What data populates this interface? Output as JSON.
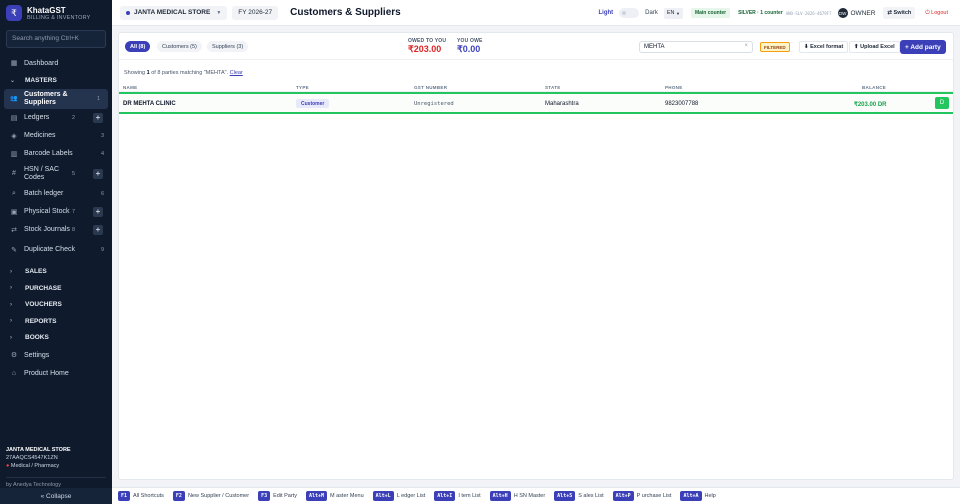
{
  "sidebar": {
    "brand_name": "KhataGST",
    "brand_sub": "BILLING & INVENTORY",
    "brand_logo": "₹",
    "search_placeholder": "Search anything   Ctrl+K",
    "dashboard": "Dashboard",
    "masters_label": "MASTERS",
    "masters": [
      {
        "label": "Customers & Suppliers",
        "num": "1",
        "icon": "people-icon"
      },
      {
        "label": "Ledgers",
        "num": "2",
        "icon": "book-icon",
        "plus": "+"
      },
      {
        "label": "Medicines",
        "num": "3",
        "icon": "tag-icon"
      },
      {
        "label": "Barcode Labels",
        "num": "4",
        "icon": "barcode-icon"
      },
      {
        "label": "HSN / SAC Codes",
        "num": "5",
        "icon": "hash-icon",
        "plus": "+"
      },
      {
        "label": "Batch ledger",
        "num": "6",
        "icon": "search-icon"
      },
      {
        "label": "Physical Stock",
        "num": "7",
        "icon": "box-icon",
        "plus": "+"
      },
      {
        "label": "Stock Journals",
        "num": "8",
        "icon": "shuffle-icon",
        "plus": "+"
      },
      {
        "label": "Duplicate Check",
        "num": "9",
        "icon": "pen-icon"
      }
    ],
    "sections": [
      "SALES",
      "PURCHASE",
      "VOUCHERS",
      "REPORTS",
      "BOOKS"
    ],
    "settings": "Settings",
    "product_home": "Product Home",
    "footer": {
      "store": "JANTA MEDICAL STORE",
      "gstin": "27AAQCS4547K1ZN",
      "type": "Medical / Pharmacy",
      "by": "by Anedya Technology"
    },
    "collapse": "« Collapse"
  },
  "topbar": {
    "store": "JANTA MEDICAL STORE",
    "fy": "FY 2026-27",
    "title": "Customers & Suppliers",
    "light": "Light",
    "dark": "Dark",
    "lang": "EN",
    "counter": "Main counter",
    "license": "SILVER · 1 counter",
    "license_code": "ANO-SLV-2026-4679F7",
    "owner_avatar": "OW",
    "owner": "OWNER",
    "switch": "⇄ Switch",
    "logout": "⏻ Logout"
  },
  "filters": {
    "tabs": [
      {
        "label": "All (8)",
        "active": true
      },
      {
        "label": "Customers (5)",
        "active": false
      },
      {
        "label": "Suppliers (3)",
        "active": false
      }
    ],
    "owed_to_you_label": "OWED TO YOU",
    "owed_to_you": "₹203.00",
    "you_owe_label": "YOU OWE",
    "you_owe": "₹0.00",
    "search_value": "MEHTA",
    "clear_icon": "×",
    "filtered": "FILTERED",
    "excel_format": "⬇ Excel format",
    "upload_excel": "⬆ Upload Excel",
    "add_party": "+ Add party"
  },
  "showing": {
    "prefix": "Showing ",
    "count": "1",
    "suffix": " of 8 parties matching \"MEHTA\". ",
    "clear": "Clear"
  },
  "table": {
    "columns": [
      "NAME",
      "TYPE",
      "GST NUMBER",
      "STATE",
      "PHONE",
      "BALANCE"
    ],
    "rows": [
      {
        "name": "DR MEHTA CLINIC",
        "type": "Customer",
        "gst": "Unregistered",
        "state": "Maharashtra",
        "phone": "9823007788",
        "balance": "₹203.00 DR",
        "action": "D"
      }
    ]
  },
  "shortcuts": [
    {
      "key": "F1",
      "label": "All Shortcuts"
    },
    {
      "key": "F2",
      "label": "New Supplier / Customer"
    },
    {
      "key": "F3",
      "label": "Edit Party"
    },
    {
      "key": "Alt+M",
      "label": "M aster Menu"
    },
    {
      "key": "Alt+L",
      "label": "L edger List"
    },
    {
      "key": "Alt+I",
      "label": "I tem List"
    },
    {
      "key": "Alt+H",
      "label": "H SN Master"
    },
    {
      "key": "Alt+S",
      "label": "S ales List"
    },
    {
      "key": "Alt+P",
      "label": "P urchase List"
    },
    {
      "key": "Alt+A",
      "label": "Help"
    }
  ],
  "colors": {
    "accent": "#3b3fb8",
    "sidebar": "#0f1b2d",
    "success": "#22c55e",
    "owed": "#dc2626",
    "owe": "#3b3fb8"
  }
}
